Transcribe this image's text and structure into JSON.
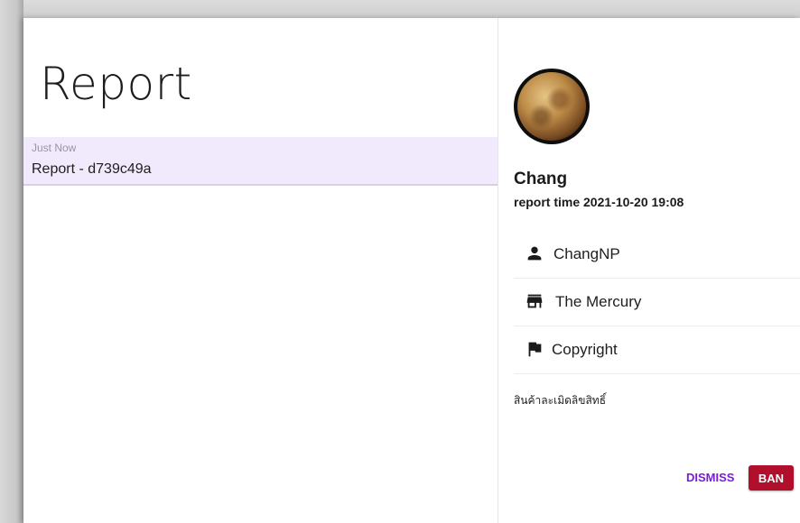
{
  "list": {
    "title": "Report",
    "items": [
      {
        "time": "Just Now",
        "name": "Report - d739c49a"
      }
    ]
  },
  "detail": {
    "user_name": "Chang",
    "report_time": "report time 2021-10-20 19:08",
    "rows": [
      {
        "icon": "person-icon",
        "label": "ChangNP"
      },
      {
        "icon": "store-icon",
        "label": "The Mercury"
      },
      {
        "icon": "flag-icon",
        "label": "Copyright"
      }
    ],
    "description": "สินค้าละเมิดลิขสิทธิ์",
    "actions": {
      "dismiss_label": "DISMISS",
      "ban_label": "BAN"
    }
  },
  "colors": {
    "selected_item_bg": "#f1eafc",
    "dismiss_text": "#7a1bd8",
    "ban_bg": "#b0102b"
  }
}
